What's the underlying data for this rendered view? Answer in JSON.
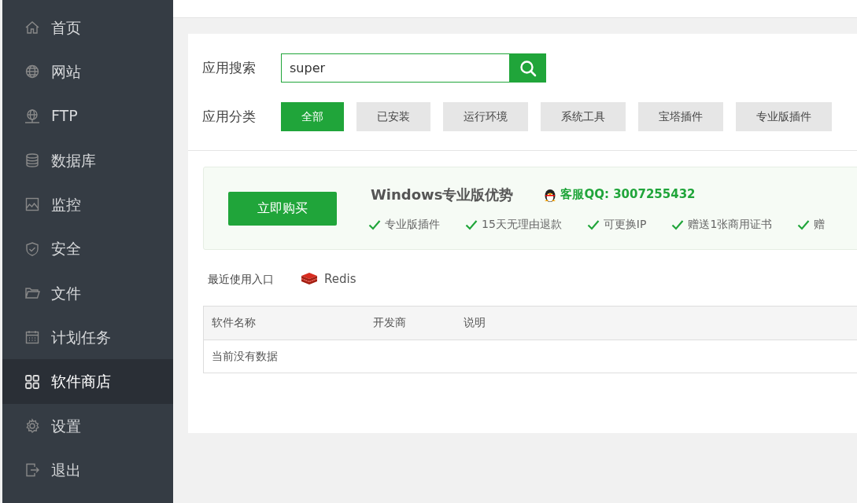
{
  "sidebar": {
    "items": [
      {
        "label": "首页",
        "selected": false
      },
      {
        "label": "网站",
        "selected": false
      },
      {
        "label": "FTP",
        "selected": false
      },
      {
        "label": "数据库",
        "selected": false
      },
      {
        "label": "监控",
        "selected": false
      },
      {
        "label": "安全",
        "selected": false
      },
      {
        "label": "文件",
        "selected": false
      },
      {
        "label": "计划任务",
        "selected": false
      },
      {
        "label": "软件商店",
        "selected": true
      },
      {
        "label": "设置",
        "selected": false
      },
      {
        "label": "退出",
        "selected": false
      }
    ]
  },
  "search": {
    "label": "应用搜索",
    "value": "super"
  },
  "categories": {
    "label": "应用分类",
    "items": [
      {
        "label": "全部",
        "selected": true
      },
      {
        "label": "已安装",
        "selected": false
      },
      {
        "label": "运行环境",
        "selected": false
      },
      {
        "label": "系统工具",
        "selected": false
      },
      {
        "label": "宝塔插件",
        "selected": false
      },
      {
        "label": "专业版插件",
        "selected": false
      }
    ]
  },
  "promo": {
    "button": "立即购买",
    "title": "Windows专业版优势",
    "contact": "客服QQ: 3007255432",
    "benefits": [
      "专业版插件",
      "15天无理由退款",
      "可更换IP",
      "赠送1张商用证书",
      "赠"
    ]
  },
  "recent": {
    "label": "最近使用入口",
    "items": [
      "Redis"
    ]
  },
  "table": {
    "columns": [
      "软件名称",
      "开发商",
      "说明"
    ],
    "empty": "当前没有数据"
  }
}
